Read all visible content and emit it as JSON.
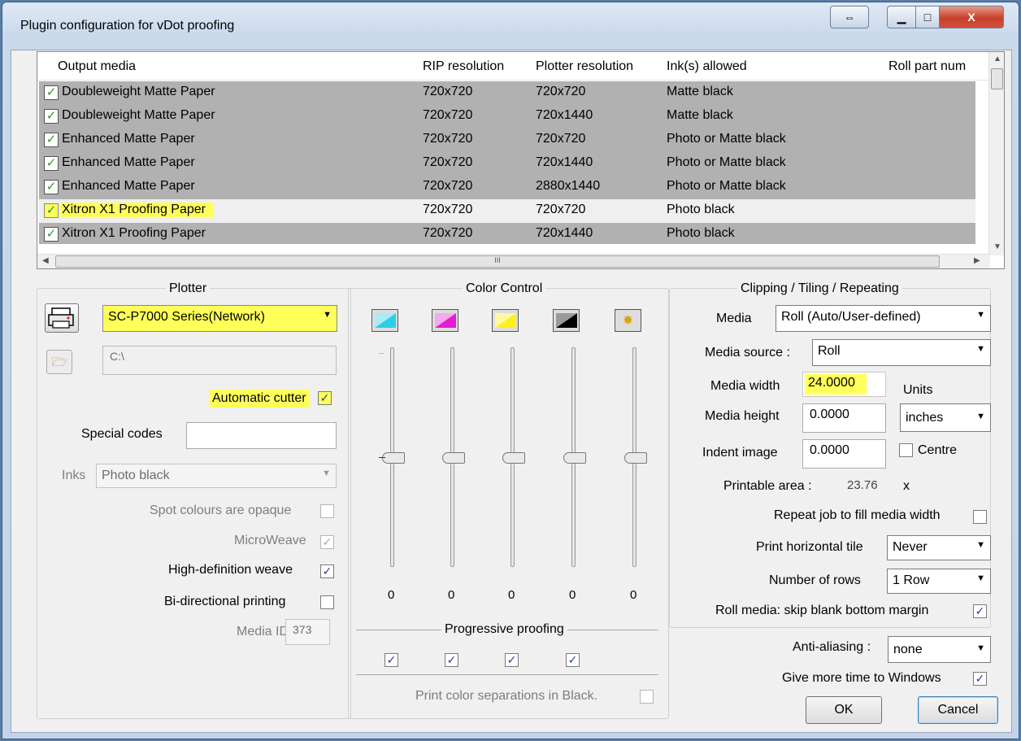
{
  "window": {
    "title": "Plugin configuration for vDot proofing",
    "buttons": {
      "restore_icon": "resize-arrows-icon",
      "minimize": "minimize-icon",
      "maximize": "maximize-icon",
      "close": "X"
    }
  },
  "media_table": {
    "headers": [
      "Output media",
      "RIP resolution",
      "Plotter resolution",
      "Ink(s) allowed",
      "Roll part num"
    ],
    "rows": [
      {
        "checked": true,
        "media": "Doubleweight Matte Paper",
        "rip": "720x720",
        "plotter": "720x720",
        "inks": "Matte black",
        "selected": false
      },
      {
        "checked": true,
        "media": "Doubleweight Matte Paper",
        "rip": "720x720",
        "plotter": "720x1440",
        "inks": "Matte black",
        "selected": false
      },
      {
        "checked": true,
        "media": "Enhanced Matte Paper",
        "rip": "720x720",
        "plotter": "720x720",
        "inks": "Photo or Matte black",
        "selected": false
      },
      {
        "checked": true,
        "media": "Enhanced Matte Paper",
        "rip": "720x720",
        "plotter": "720x1440",
        "inks": "Photo or Matte black",
        "selected": false
      },
      {
        "checked": true,
        "media": "Enhanced Matte Paper",
        "rip": "720x720",
        "plotter": "2880x1440",
        "inks": "Photo or Matte black",
        "selected": false
      },
      {
        "checked": true,
        "media": "Xitron X1 Proofing Paper",
        "rip": "720x720",
        "plotter": "720x720",
        "inks": "Photo black",
        "selected": true
      },
      {
        "checked": true,
        "media": "Xitron X1 Proofing Paper",
        "rip": "720x720",
        "plotter": "720x1440",
        "inks": "Photo black",
        "selected": false
      }
    ],
    "hscroll_grip": "III"
  },
  "plotter": {
    "legend": "Plotter",
    "printer_select": "SC-P7000 Series(Network)",
    "path": "C:\\",
    "automatic_cutter_label": "Automatic cutter",
    "special_codes_label": "Special codes",
    "special_codes_value": "",
    "inks_label": "Inks",
    "inks_value": "Photo black",
    "spot_opaque_label": "Spot colours are opaque",
    "microweave_label": "MicroWeave",
    "hd_weave_label": "High-definition weave",
    "bidirectional_label": "Bi-directional printing",
    "media_id_label": "Media ID",
    "media_id_value": "373"
  },
  "color_control": {
    "legend": "Color Control",
    "channels": [
      {
        "name": "cyan",
        "value": "0"
      },
      {
        "name": "magenta",
        "value": "0"
      },
      {
        "name": "yellow",
        "value": "0"
      },
      {
        "name": "black",
        "value": "0"
      },
      {
        "name": "spot",
        "value": "0"
      }
    ],
    "progressive_label": "Progressive proofing",
    "print_separations_label": "Print color separations in Black."
  },
  "clipping": {
    "legend": "Clipping / Tiling / Repeating",
    "media_label": "Media",
    "media_value": "Roll (Auto/User-defined)",
    "media_source_label": "Media source :",
    "media_source_value": "Roll",
    "media_width_label": "Media width",
    "media_width_value": "24.0000",
    "media_height_label": "Media height",
    "media_height_value": "0.0000",
    "indent_label": "Indent image",
    "indent_value": "0.0000",
    "units_label": "Units",
    "units_value": "inches",
    "centre_label": "Centre",
    "printable_label": "Printable area :",
    "printable_value": "23.76",
    "printable_x": "x",
    "repeat_label": "Repeat job to fill media width",
    "htile_label": "Print horizontal tile",
    "htile_value": "Never",
    "rows_label": "Number of rows",
    "rows_value": "1 Row",
    "skip_margin_label": "Roll media: skip blank bottom margin"
  },
  "footer": {
    "antialias_label": "Anti-aliasing :",
    "antialias_value": "none",
    "more_time_label": "Give more time to Windows",
    "ok": "OK",
    "cancel": "Cancel"
  },
  "colors": {
    "highlight": "#ffff5a",
    "row_gray": "#b1b1b1",
    "checkbox_blue": "#20409a"
  }
}
